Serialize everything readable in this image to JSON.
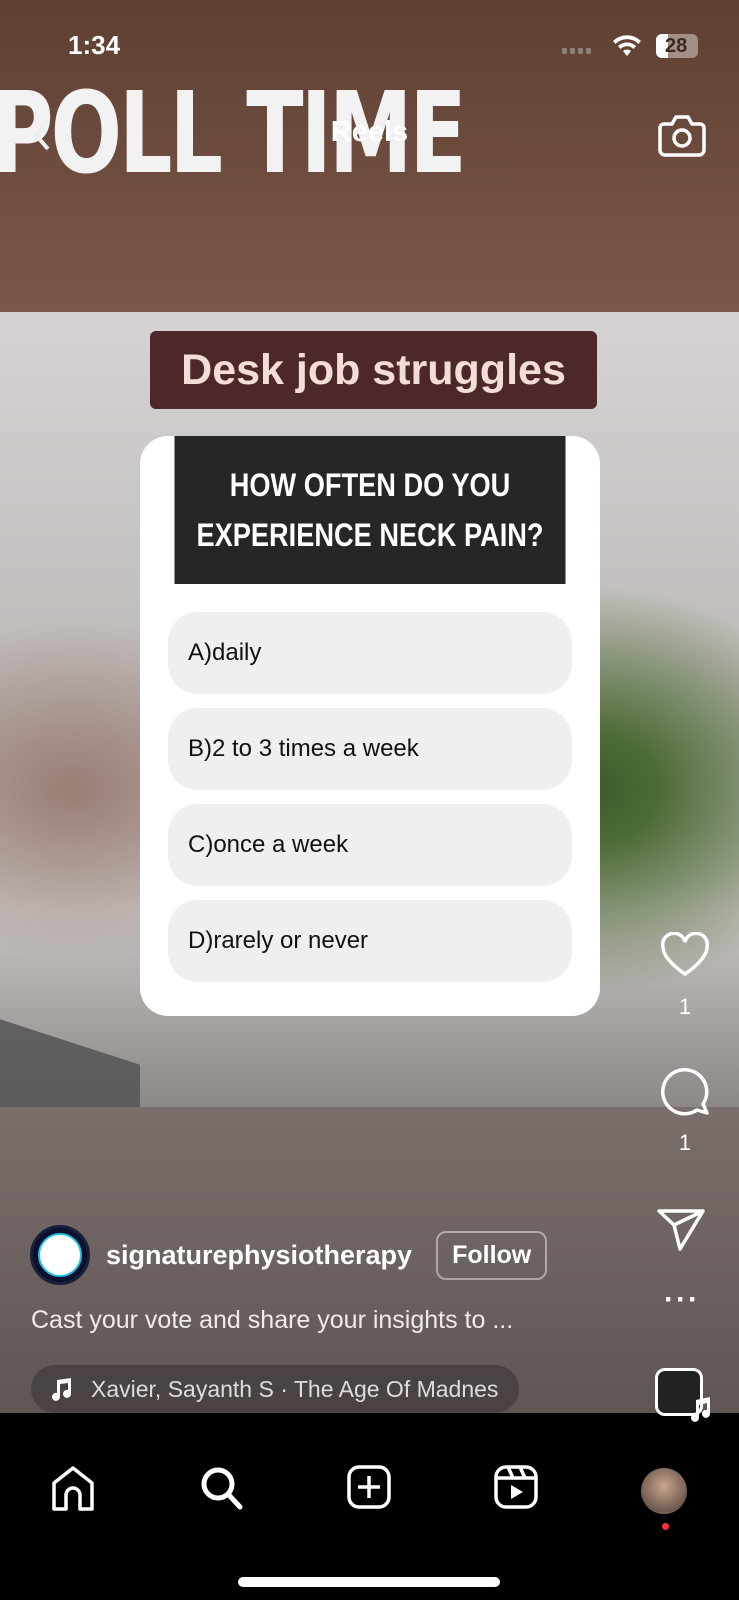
{
  "status_bar": {
    "time": "1:34",
    "battery": "28"
  },
  "header": {
    "title": "Reels"
  },
  "video": {
    "overlay_text": "POLL TIME",
    "badge": "Desk job struggles",
    "poll": {
      "question_line1": "HOW OFTEN DO YOU",
      "question_line2": "EXPERIENCE NECK PAIN?",
      "options": [
        "A)daily",
        "B)2 to 3 times a week",
        "C)once a week",
        "D)rarely or never"
      ]
    }
  },
  "actions": {
    "likes": "1",
    "comments": "1"
  },
  "post": {
    "username": "signaturephysiotherapy",
    "follow_label": "Follow",
    "caption": "Cast your vote and share your insights to ...",
    "audio": "Xavier, Sayanth S · The Age Of Madnes"
  },
  "colors": {
    "badge_bg": "#4d282a",
    "poll_header": "#262626",
    "notification_dot": "#ff3040"
  }
}
